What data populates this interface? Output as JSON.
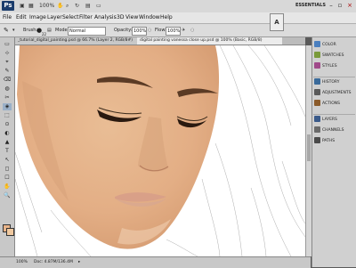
{
  "appbar": {
    "logo": "Ps",
    "zoom": "100%",
    "workspace": "ESSENTIALS",
    "close_glyph": "×"
  },
  "menu": [
    "File",
    "Edit",
    "Image",
    "Layer",
    "Select",
    "Filter",
    "Analysis",
    "3D",
    "View",
    "Window",
    "Help"
  ],
  "options": {
    "brush_label": "Brush:",
    "brush_size": "22",
    "mode_label": "Mode:",
    "mode_value": "Normal",
    "opacity_label": "Opacity:",
    "opacity_value": "100%",
    "flow_label": "Flow:",
    "flow_value": "100%"
  },
  "tabs": [
    "_tutorial_digital_painting.psd @ 66.7% (Layer 2, RGB/8#)",
    "digital painting vanessa close up.psd @ 100% (Basic, RGB/8)"
  ],
  "tools": [
    "▭",
    "⊹",
    "⌖",
    "✎",
    "⌫",
    "◍",
    "✂",
    "◈",
    "⬚",
    "⊙",
    "◐",
    "▲",
    "T",
    "↖",
    "◻",
    "☐",
    "✋",
    "🔍"
  ],
  "colors": {
    "foreground": "#e8b48a",
    "background": "#f0c9a0"
  },
  "panels": [
    {
      "label": "COLOR",
      "icon_color": "#4a7fbf"
    },
    {
      "label": "SWATCHES",
      "icon_color": "#7a9a3a"
    },
    {
      "label": "STYLES",
      "icon_color": "#a04a8a"
    },
    {
      "label": "HISTORY",
      "icon_color": "#3a6a9a"
    },
    {
      "label": "ADJUSTMENTS",
      "icon_color": "#5a5a5a"
    },
    {
      "label": "ACTIONS",
      "icon_color": "#8a5a2a"
    },
    {
      "label": "LAYERS",
      "icon_color": "#3a5a8a"
    },
    {
      "label": "CHANNELS",
      "icon_color": "#6a6a6a"
    },
    {
      "label": "PATHS",
      "icon_color": "#4a4a4a"
    }
  ],
  "status": {
    "zoom": "100%",
    "doc_info": "Doc: 4.87M/136.4M"
  }
}
